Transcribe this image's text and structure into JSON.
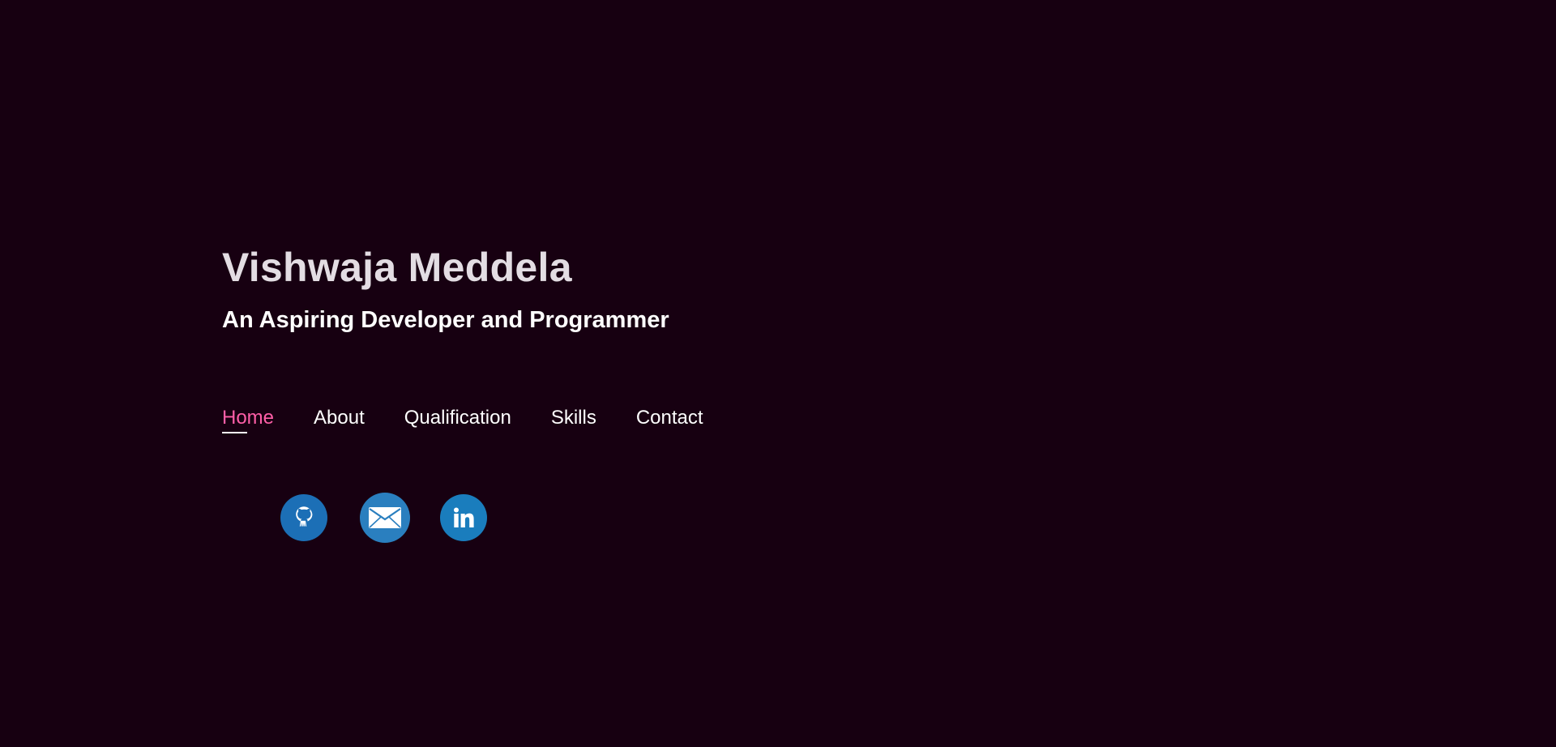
{
  "hero": {
    "name": "Vishwaja Meddela",
    "tagline": "An Aspiring Developer and Programmer"
  },
  "nav": {
    "items": [
      {
        "label": "Home",
        "active": true
      },
      {
        "label": "About",
        "active": false
      },
      {
        "label": "Qualification",
        "active": false
      },
      {
        "label": "Skills",
        "active": false
      },
      {
        "label": "Contact",
        "active": false
      }
    ]
  },
  "socials": [
    {
      "icon": "github-icon",
      "color": "#1c6fb6"
    },
    {
      "icon": "email-icon",
      "color": "#2a7fbf"
    },
    {
      "icon": "linkedin-icon",
      "color": "#1a7dbd"
    }
  ],
  "colors": {
    "background": "#170011",
    "accent": "#ff5fa8",
    "text": "#ffffff"
  }
}
